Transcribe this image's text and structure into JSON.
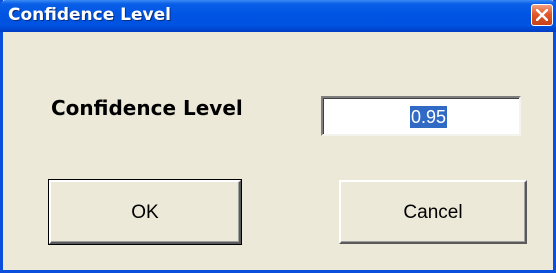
{
  "window": {
    "title": "Confidence Level"
  },
  "form": {
    "label": "Confidence Level",
    "value": "0.95"
  },
  "buttons": {
    "ok_label": "OK",
    "cancel_label": "Cancel"
  },
  "colors": {
    "titlebar": "#0054e3",
    "dialog_bg": "#ece9d8",
    "selection": "#316ac5",
    "close": "#e2582a"
  },
  "icons": {
    "close": "close-icon"
  }
}
